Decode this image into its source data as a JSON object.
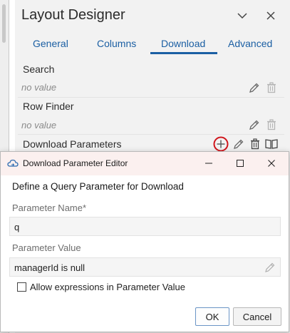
{
  "designer": {
    "title": "Layout Designer",
    "tabs": [
      {
        "label": "General"
      },
      {
        "label": "Columns"
      },
      {
        "label": "Download"
      },
      {
        "label": "Advanced"
      }
    ],
    "active_tab": "Download",
    "sections": [
      {
        "label": "Search",
        "value": "no value"
      },
      {
        "label": "Row Finder",
        "value": "no value"
      },
      {
        "label": "Download Parameters"
      }
    ]
  },
  "dialog": {
    "title": "Download Parameter Editor",
    "heading": "Define a Query Parameter for Download",
    "param_name": {
      "label": "Parameter Name*",
      "value": "q"
    },
    "param_value": {
      "label": "Parameter Value",
      "value": "managerId is null"
    },
    "checkbox": {
      "label": "Allow expressions in Parameter Value",
      "checked": false
    },
    "ok_label": "OK",
    "cancel_label": "Cancel"
  },
  "colors": {
    "accent": "#1b5fa3",
    "highlight_circle": "#d0151b",
    "dialog_titlebar": "#fbf0ef"
  },
  "icons": {
    "edit": "pencil-icon",
    "delete": "trash-icon",
    "add": "plus-circle-icon",
    "help": "book-icon"
  }
}
